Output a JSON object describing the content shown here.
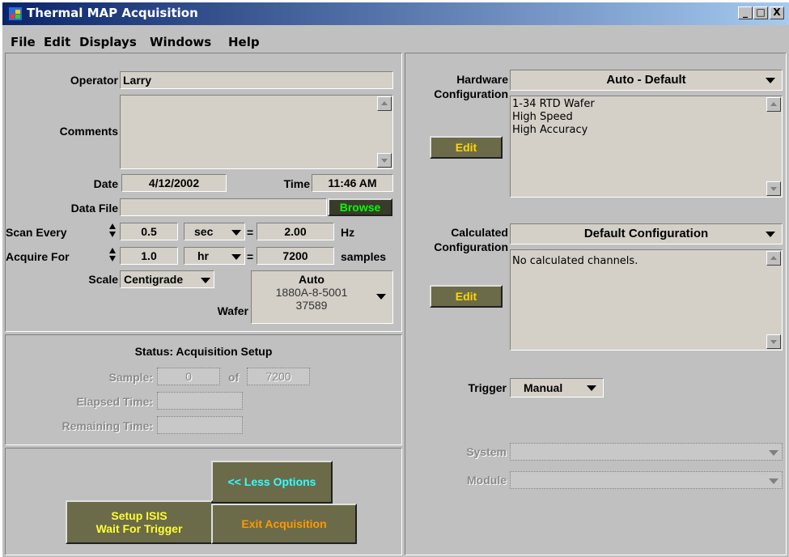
{
  "window": {
    "title": "Thermal MAP Acquisition",
    "minimize": "_",
    "restore": "□",
    "close": "X"
  },
  "menu": [
    "File",
    "Edit",
    "Displays",
    "Windows",
    "Help"
  ],
  "setup": {
    "operator_label": "Operator",
    "operator_value": "Larry",
    "comments_label": "Comments",
    "comments_value": "",
    "date_label": "Date",
    "date_value": "4/12/2002",
    "time_label": "Time",
    "time_value": "11:46 AM",
    "datafile_label": "Data File",
    "datafile_value": "",
    "browse_label": "Browse",
    "scan_label": "Scan Every",
    "scan_value": "0.5",
    "scan_unit": "sec",
    "scan_eq": "=",
    "scan_rate": "2.00",
    "scan_rate_unit": "Hz",
    "acquire_label": "Acquire For",
    "acquire_value": "1.0",
    "acquire_unit": "hr",
    "acquire_eq": "=",
    "acquire_samples": "7200",
    "acquire_samples_unit": "samples",
    "scale_label": "Scale",
    "scale_value": "Centigrade",
    "wafer_label": "Wafer",
    "wafer_line1": "Auto",
    "wafer_line2": "1880A-8-5001",
    "wafer_line3": "37589"
  },
  "status": {
    "title": "Status: Acquisition Setup",
    "sample_label": "Sample:",
    "sample_value": "0",
    "of_label": "of",
    "sample_total": "7200",
    "elapsed_label": "Elapsed Time:",
    "elapsed_value": "",
    "remaining_label": "Remaining Time:",
    "remaining_value": ""
  },
  "actions": {
    "less_options": "<< Less Options",
    "setup_line1": "Setup ISIS",
    "setup_line2": "Wait For Trigger",
    "exit": "Exit Acquisition"
  },
  "hardware": {
    "label1": "Hardware",
    "label2": "Configuration",
    "selected": "Auto - Default",
    "edit": "Edit",
    "lines": [
      "1-34 RTD Wafer",
      "High Speed",
      "High Accuracy"
    ]
  },
  "calculated": {
    "label1": "Calculated",
    "label2": "Configuration",
    "selected": "Default Configuration",
    "edit": "Edit",
    "lines": [
      "No calculated channels."
    ]
  },
  "trigger": {
    "label": "Trigger",
    "value": "Manual"
  },
  "system": {
    "label": "System",
    "value": ""
  },
  "module": {
    "label": "Module",
    "value": ""
  },
  "colors": {
    "title_start": "#0a246a",
    "title_end": "#a6caf0",
    "browse_green": "#00ff00",
    "less_options_cyan": "#33ffff",
    "setup_yellow": "#ffff33",
    "exit_orange": "#ff9900",
    "edit_yellow": "#ffd700"
  }
}
